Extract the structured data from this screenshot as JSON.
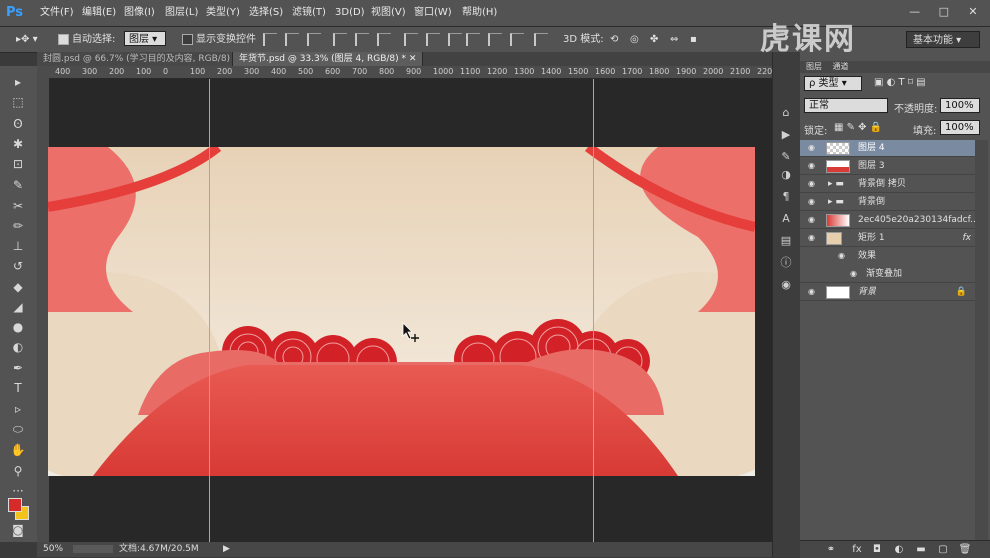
{
  "app": {
    "logo": "Ps",
    "menus": [
      "文件(F)",
      "编辑(E)",
      "图像(I)",
      "图层(L)",
      "类型(Y)",
      "选择(S)",
      "滤镜(T)",
      "3D(D)",
      "视图(V)",
      "窗口(W)",
      "帮助(H)"
    ],
    "window_controls": [
      "—",
      "□",
      "✕"
    ]
  },
  "options_bar": {
    "auto_select_label": "自动选择:",
    "auto_select_value": "图层",
    "show_transform_label": "显示变换控件",
    "mode_3d_label": "3D 模式:",
    "workspace": "基本功能"
  },
  "tabs": [
    {
      "label": "封圆.psd @ 66.7% (学习目的及内容, RGB/8)",
      "active": false
    },
    {
      "label": "年货节.psd @ 33.3% (图层 4, RGB/8) *",
      "active": true
    }
  ],
  "ruler_ticks": [
    "400",
    "300",
    "200",
    "100",
    "0",
    "100",
    "200",
    "300",
    "400",
    "500",
    "600",
    "700",
    "800",
    "900",
    "1000",
    "1100",
    "1200",
    "1300",
    "1400",
    "1500",
    "1600",
    "1700",
    "1800",
    "1900",
    "2000",
    "2100",
    "2200"
  ],
  "status": {
    "zoom": "50%",
    "doc": "文档:4.67M/20.5M"
  },
  "panel": {
    "tabs": [
      "图层",
      "通道"
    ],
    "filter_label": "ρ 类型",
    "blend_mode": "正常",
    "opacity_label": "不透明度:",
    "opacity_value": "100%",
    "lock_label": "锁定:",
    "fill_label": "填充:",
    "fill_value": "100%",
    "layers": [
      {
        "name": "图层 4",
        "selected": true,
        "kind": "pixel"
      },
      {
        "name": "图层 3",
        "selected": false,
        "kind": "pixel"
      },
      {
        "name": "背景倒 拷贝",
        "selected": false,
        "kind": "group"
      },
      {
        "name": "背景倒",
        "selected": false,
        "kind": "group"
      },
      {
        "name": "2ec405e20a230134fadcf...",
        "selected": false,
        "kind": "smart"
      },
      {
        "name": "矩形 1",
        "selected": false,
        "kind": "shape",
        "fx": "fx"
      },
      {
        "name": "效果",
        "selected": false,
        "kind": "effect"
      },
      {
        "name": "渐变叠加",
        "selected": false,
        "kind": "effect-item"
      },
      {
        "name": "背景",
        "selected": false,
        "kind": "background"
      }
    ]
  },
  "colors": {
    "foreground": "#d62b2b",
    "background": "#f2c31a",
    "guide": "#3fd1d6",
    "accent_red": "#e23a3a"
  }
}
